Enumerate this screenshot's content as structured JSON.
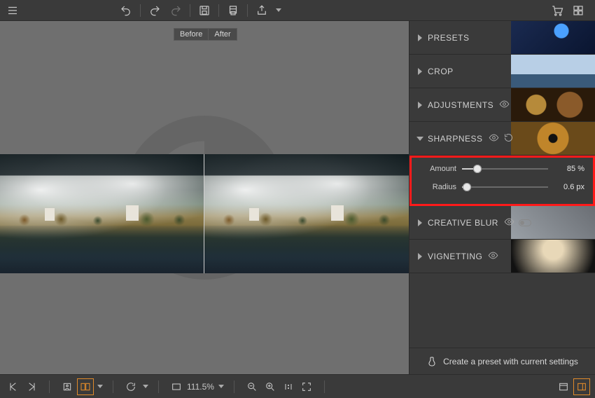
{
  "toolbar": {
    "menu": "menu",
    "undo": "undo",
    "redo": "redo",
    "redo2": "redo-step",
    "save": "save",
    "print": "print",
    "export": "export",
    "cart": "cart",
    "grid": "grid"
  },
  "compare": {
    "before": "Before",
    "after": "After"
  },
  "panels": {
    "presets": {
      "label": "PRESETS"
    },
    "crop": {
      "label": "CROP"
    },
    "adjustments": {
      "label": "ADJUSTMENTS"
    },
    "sharpness": {
      "label": "SHARPNESS"
    },
    "creative_blur": {
      "label": "CREATIVE BLUR"
    },
    "vignetting": {
      "label": "VIGNETTING"
    }
  },
  "sharpness": {
    "amount": {
      "label": "Amount",
      "value_text": "85 %",
      "value": 85,
      "min": 0,
      "max": 100
    },
    "radius": {
      "label": "Radius",
      "value_text": "0.6 px",
      "value": 0.6,
      "min": 0,
      "max": 10
    }
  },
  "footer": {
    "zoom_text": "111.5%",
    "create_preset": "Create a preset with current settings"
  }
}
